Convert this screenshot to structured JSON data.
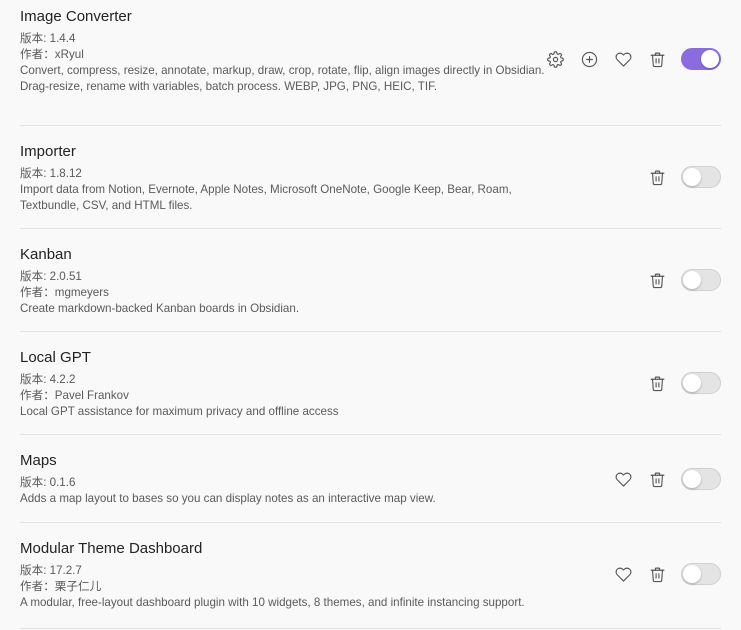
{
  "version_prefix": "版本: ",
  "author_prefix": "作者：",
  "accent_color": "#8b6cdf",
  "plugins": [
    {
      "name": "Image Converter",
      "version": "1.4.4",
      "author": "xRyul",
      "description": "Convert, compress, resize, annotate, markup, draw, crop, rotate, flip, align images directly in Obsidian. Drag-resize, rename with variables, batch process. WEBP, JPG, PNG, HEIC, TIF.",
      "enabled": true,
      "controls": [
        "gear-icon",
        "plus-circle-icon",
        "heart-icon",
        "trash-icon"
      ]
    },
    {
      "name": "Importer",
      "version": "1.8.12",
      "description": "Import data from Notion, Evernote, Apple Notes, Microsoft OneNote, Google Keep, Bear, Roam, Textbundle, CSV, and HTML files.",
      "enabled": false,
      "controls": [
        "trash-icon"
      ]
    },
    {
      "name": "Kanban",
      "version": "2.0.51",
      "author": "mgmeyers",
      "description": "Create markdown-backed Kanban boards in Obsidian.",
      "enabled": false,
      "controls": [
        "trash-icon"
      ]
    },
    {
      "name": "Local GPT",
      "version": "4.2.2",
      "author": "Pavel Frankov",
      "description": "Local GPT assistance for maximum privacy and offline access",
      "enabled": false,
      "controls": [
        "trash-icon"
      ]
    },
    {
      "name": "Maps",
      "version": "0.1.6",
      "description": "Adds a map layout to bases so you can display notes as an interactive map view.",
      "enabled": false,
      "controls": [
        "heart-icon",
        "trash-icon"
      ]
    },
    {
      "name": "Modular Theme Dashboard",
      "version": "17.2.7",
      "author": "栗子仁儿",
      "description": "A modular, free-layout dashboard plugin with 10 widgets, 8 themes, and infinite instancing support.",
      "enabled": false,
      "controls": [
        "heart-icon",
        "trash-icon"
      ]
    }
  ]
}
